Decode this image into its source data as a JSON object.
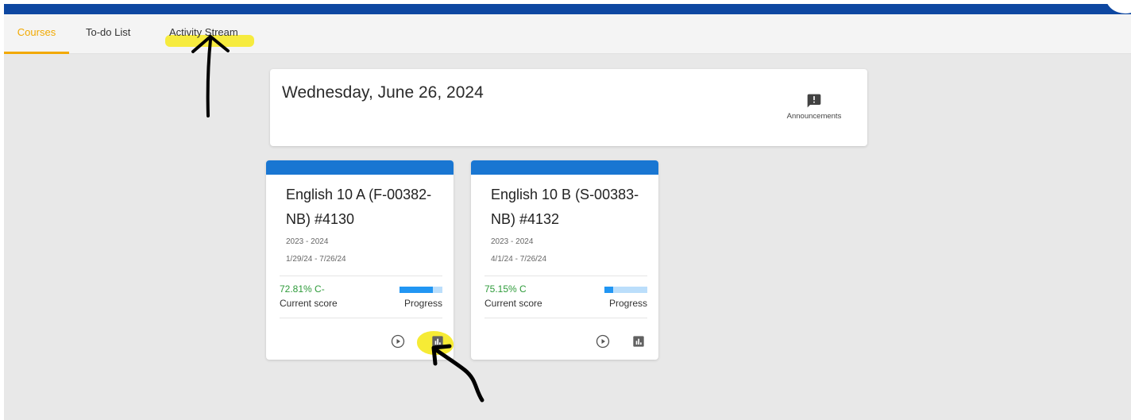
{
  "tabs": [
    {
      "label": "Courses",
      "active": true
    },
    {
      "label": "To-do List",
      "active": false
    },
    {
      "label": "Activity Stream",
      "active": false
    }
  ],
  "header": {
    "date": "Wednesday, June 26, 2024",
    "announcements_label": "Announcements",
    "announcements_icon": "announcement-icon"
  },
  "courses": [
    {
      "title": "English 10 A (F-00382-NB) #4130",
      "year": "2023 - 2024",
      "dates": "1/29/24 - 7/26/24",
      "score": "72.81% C-",
      "score_label": "Current score",
      "progress_label": "Progress",
      "progress_fraction": 0.78
    },
    {
      "title": "English 10 B (S-00383-NB) #4132",
      "year": "2023 - 2024",
      "dates": "4/1/24 - 7/26/24",
      "score": "75.15% C",
      "score_label": "Current score",
      "progress_label": "Progress",
      "progress_fraction": 0.2
    }
  ],
  "icons": {
    "play": "play-circle-icon",
    "grades": "bar-chart-icon"
  },
  "colors": {
    "topbar": "#0d47a1",
    "active_tab": "#f2a900",
    "card_stripe": "#1976d2",
    "score": "#2e9b3a",
    "progress_fill": "#2196f3",
    "progress_track": "#bbdefb",
    "highlight": "#f6ea2a",
    "annotation_arrow": "#000000"
  }
}
